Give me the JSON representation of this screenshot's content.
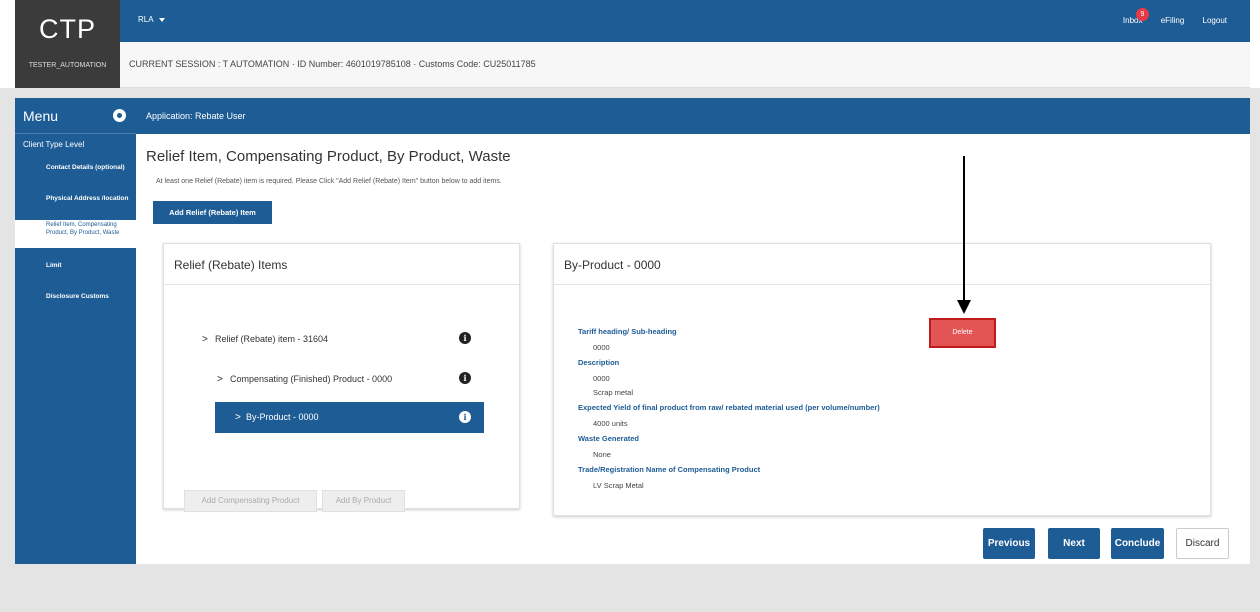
{
  "header": {
    "logo_title": "CTP",
    "logo_user": "TESTER_AUTOMATION",
    "menu_label": "RLA",
    "inbox_label": "Inbox",
    "inbox_count": "9",
    "efiling_label": "eFiling",
    "logout_label": "Logout"
  },
  "session": {
    "text": "CURRENT SESSION : T AUTOMATION  ·  ID Number: 4601019785108  ·  Customs Code: CU25011785"
  },
  "sidebar": {
    "title": "Menu",
    "section": "Client Type Level",
    "items": [
      {
        "label": "Contact Details (optional)"
      },
      {
        "label": "Physical Address /location"
      },
      {
        "label": "Relief Item, Compensating Product, By Product, Waste"
      },
      {
        "label": "Limit"
      },
      {
        "label": "Disclosure Customs"
      }
    ]
  },
  "main": {
    "application_label": "Application: Rebate User",
    "page_title": "Relief Item, Compensating Product, By Product, Waste",
    "hint": "At least one Relief (Rebate) item is required. Please Click \"Add Relief (Rebate) Item\" button below to add items.",
    "add_relief_button": "Add Relief (Rebate) Item"
  },
  "left_panel": {
    "title": "Relief (Rebate) Items",
    "tree": [
      {
        "label": "Relief (Rebate) item - 31604"
      },
      {
        "label": "Compensating (Finished) Product - 0000"
      },
      {
        "label": "By-Product - 0000"
      }
    ],
    "chevron": ">",
    "info_glyph": "i",
    "add_compensating_button": "Add Compensating Product",
    "add_by_product_button": "Add By Product"
  },
  "right_panel": {
    "title": "By-Product - 0000",
    "delete_button": "Delete",
    "fields": [
      {
        "label": "Tariff heading/ Sub-heading",
        "values": [
          "0000"
        ]
      },
      {
        "label": "Description",
        "values": [
          "0000",
          "Scrap metal"
        ]
      },
      {
        "label": "Expected Yield of final product from raw/ rebated material used (per volume/number)",
        "values": [
          "4000 units"
        ]
      },
      {
        "label": "Waste Generated",
        "values": [
          "None"
        ]
      },
      {
        "label": "Trade/Registration Name of Compensating Product",
        "values": [
          "LV Scrap Metal"
        ]
      }
    ]
  },
  "footer": {
    "previous": "Previous",
    "next": "Next",
    "conclude": "Conclude",
    "discard": "Discard"
  },
  "colors": {
    "brand_blue": "#1d5c94",
    "delete_red": "#e35555",
    "badge_red": "#e53945"
  }
}
